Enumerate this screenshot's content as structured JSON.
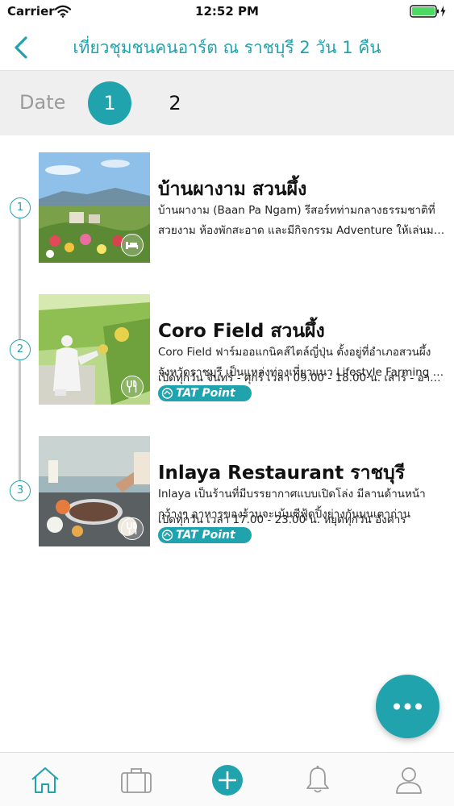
{
  "status_bar": {
    "carrier": "Carrier",
    "time": "12:52 PM"
  },
  "header": {
    "title": "เที่ยวชุมชนคนอาร์ต ณ ราชบุรี 2 วัน 1 คืน"
  },
  "date_selector": {
    "label": "Date",
    "days": [
      "1",
      "2"
    ],
    "selected": "1"
  },
  "places": [
    {
      "step": "1",
      "title": "บ้านผางาม สวนผึ้ง",
      "desc": [
        "บ้านผางาม (Baan Pa Ngam) รีสอร์ทท่ามกลางธรรมชาติที่",
        "สวยงาม ห้องพักสะอาด และมีกิจกรรม Adventure ให้เล่นมา..."
      ],
      "hours": "",
      "badge_icon": "bed-icon",
      "tat_point": ""
    },
    {
      "step": "2",
      "title": "Coro Field สวนผึ้ง",
      "desc": [
        "Coro Field ฟาร์มออแกนิคส์ไตล์ญี่ปุ่น ตั้งอยู่ที่อำเภอสวนผึ้ง",
        "จังหวัดราชบุรี เป็นแหล่งท่องเที่ยวแนว Lifestyle Farming อ..."
      ],
      "hours": "เปิดทุกวัน จันทร์ - ศุกร์ เวลา 09.00 - 18.00 น. เสาร์ - อาทิ...",
      "badge_icon": "dining-icon",
      "tat_point": "TAT Point"
    },
    {
      "step": "3",
      "title": "Inlaya Restaurant ราชบุรี",
      "desc": [
        "Inlaya เป็นร้านที่มีบรรยากาศแบบเปิดโล่ง มีลานด้านหน้า",
        "กว้างๆ อาหารของร้านจะเน้นซีฟู้ดปิ้งย่างกันบนเตาถ่าน"
      ],
      "hours": "เปิดทุกวัน เวลา 17.00 - 23.00 น. หยุดทุกวัน อังคาร",
      "badge_icon": "dining-icon",
      "tat_point": "TAT Point"
    }
  ],
  "colors": {
    "accent": "#21a3ad",
    "date_bar_bg": "#efefef",
    "timeline": "#c7c7c7"
  },
  "tab_bar": {
    "items": [
      "home-icon",
      "briefcase-icon",
      "add-icon",
      "bell-icon",
      "profile-icon"
    ]
  }
}
